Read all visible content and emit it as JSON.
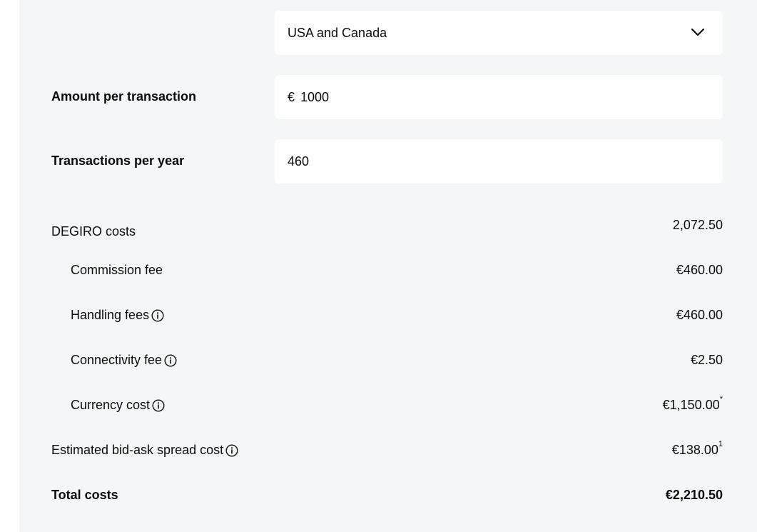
{
  "region_select": {
    "value": "USA and Canada",
    "icon": "chevron-down-icon"
  },
  "amount_per_transaction": {
    "label": "Amount per transaction",
    "currency_symbol": "€",
    "value": "1000"
  },
  "transactions_per_year": {
    "label": "Transactions per year",
    "value": "460"
  },
  "costs": {
    "degiro_costs": {
      "label": "DEGIRO costs",
      "value": "2,072.50"
    },
    "commission_fee": {
      "label": "Commission fee",
      "value": "€460.00"
    },
    "handling_fees": {
      "label": "Handling fees",
      "value": "€460.00",
      "icon": "info-icon"
    },
    "connectivity_fee": {
      "label": "Connectivity fee",
      "value": "€2.50",
      "icon": "info-icon"
    },
    "currency_cost": {
      "label": "Currency cost",
      "value": "€1,150.00",
      "footnote": "*",
      "icon": "info-icon"
    },
    "bid_ask_spread": {
      "label": "Estimated bid-ask spread cost",
      "value": "€138.00",
      "footnote": "1",
      "icon": "info-icon"
    },
    "total": {
      "label": "Total costs",
      "value": "€2,210.50"
    }
  },
  "colors": {
    "panel_background": "#f5f6f8",
    "field_background": "#ffffff",
    "text": "#0b0c0e"
  }
}
